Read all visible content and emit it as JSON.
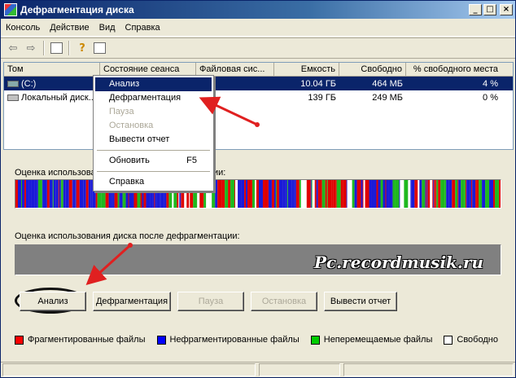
{
  "window": {
    "title": "Дефрагментация диска",
    "minimize_glyph": "_",
    "maximize_glyph": "□",
    "close_glyph": "×"
  },
  "menubar": [
    "Консоль",
    "Действие",
    "Вид",
    "Справка"
  ],
  "toolbar": {
    "back_glyph": "⇦",
    "forward_glyph": "⇨",
    "help_glyph": "?"
  },
  "list": {
    "columns": [
      "Том",
      "Состояние сеанса",
      "Файловая сис...",
      "Емкость",
      "Свободно",
      "% свободного места"
    ],
    "rows": [
      {
        "volume": "(C:)",
        "state": "",
        "fs": "FS",
        "capacity": "10.04 ГБ",
        "free": "464 МБ",
        "pct": "4 %"
      },
      {
        "volume": "Локальный диск...",
        "state": "",
        "fs": "FS",
        "capacity": "139 ГБ",
        "free": "249 МБ",
        "pct": "0 %"
      }
    ]
  },
  "context_menu": {
    "items": [
      {
        "label": "Анализ",
        "shortcut": ""
      },
      {
        "label": "Дефрагментация",
        "shortcut": ""
      },
      {
        "label": "Пауза",
        "shortcut": ""
      },
      {
        "label": "Остановка",
        "shortcut": ""
      },
      {
        "label": "Вывести отчет",
        "shortcut": ""
      },
      {
        "label": "Обновить",
        "shortcut": "F5"
      },
      {
        "label": "Справка",
        "shortcut": ""
      }
    ]
  },
  "usage": {
    "before_label_start": "Оценка использова",
    "before_label_end": "ии:",
    "after_label": "Оценка использования диска после дефрагментации:",
    "watermark": "Pc.recordmusik.ru"
  },
  "buttons": {
    "analyze": "Анализ",
    "defrag": "Дефрагментация",
    "pause": "Пауза",
    "stop": "Остановка",
    "report": "Вывести отчет"
  },
  "legend": [
    {
      "label": "Фрагментированные файлы",
      "color": "#ff0000"
    },
    {
      "label": "Нефрагментированные файлы",
      "color": "#0000ff"
    },
    {
      "label": "Неперемещаемые файлы",
      "color": "#00cc00"
    },
    {
      "label": "Свободно",
      "color": "#ffffff"
    }
  ],
  "colors": {
    "fragmented": "#e00000",
    "contiguous": "#1a1ad8",
    "unmovable": "#1fb81f",
    "free": "#ffffff",
    "arrow": "#e02020"
  }
}
